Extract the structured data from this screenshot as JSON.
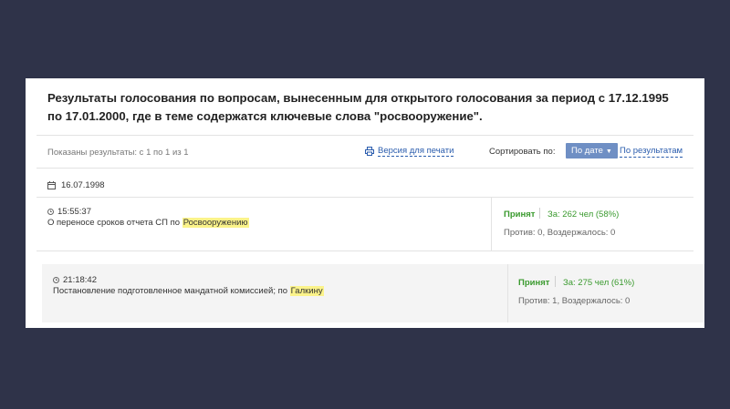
{
  "title": "Результаты голосования по вопросам, вынесенным для открытого голосования за период с 17.12.1995 по 17.01.2000, где в теме содержатся ключевые слова \"росвооружение\".",
  "results_info": "Показаны результаты: с 1 по 1 из 1",
  "print_label": "Версия для печати",
  "sort": {
    "label": "Сортировать по:",
    "active": "По дате",
    "alternative": "По результатам"
  },
  "date": "16.07.1998",
  "votes": [
    {
      "time": "15:55:37",
      "desc_prefix": "О переносе сроков отчета СП по ",
      "keyword": "Росвооружению",
      "verdict": "Принят",
      "za": "За: 262 чел (58%)",
      "other": "Против: 0, Воздержалось: 0"
    },
    {
      "time": "21:18:42",
      "desc_prefix": "Постановление подготовленное мандатной комиссией; по ",
      "keyword": "Галкину",
      "verdict": "Принят",
      "za": "За: 275 чел (61%)",
      "other": "Против: 1, Воздержалось: 0"
    }
  ],
  "colors": {
    "background": "#2f3349",
    "accept_green": "#3a9a2e",
    "link_blue": "#2a5cad",
    "sort_button": "#6f8fc4",
    "highlight": "#fbf38a"
  },
  "icons": [
    "printer-icon",
    "calendar-icon",
    "clock-icon",
    "caret-down-icon"
  ]
}
